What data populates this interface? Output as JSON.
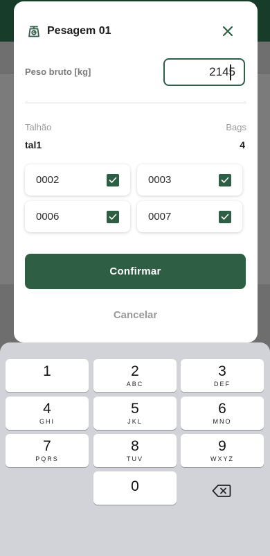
{
  "modal": {
    "title": "Pesagem 01",
    "peso_label": "Peso bruto [kg]",
    "peso_value": "2145",
    "talhao_header": "Talhão",
    "bags_header": "Bags",
    "talhao_value": "tal1",
    "bags_value": "4",
    "bags": [
      {
        "code": "0002",
        "checked": true
      },
      {
        "code": "0003",
        "checked": true
      },
      {
        "code": "0006",
        "checked": true
      },
      {
        "code": "0007",
        "checked": true
      }
    ],
    "confirm_label": "Confirmar",
    "cancel_label": "Cancelar"
  },
  "keyboard": {
    "keys": [
      {
        "num": "1",
        "letters": ""
      },
      {
        "num": "2",
        "letters": "ABC"
      },
      {
        "num": "3",
        "letters": "DEF"
      },
      {
        "num": "4",
        "letters": "GHI"
      },
      {
        "num": "5",
        "letters": "JKL"
      },
      {
        "num": "6",
        "letters": "MNO"
      },
      {
        "num": "7",
        "letters": "PQRS"
      },
      {
        "num": "8",
        "letters": "TUV"
      },
      {
        "num": "9",
        "letters": "WXYZ"
      },
      {
        "num": "0",
        "letters": ""
      }
    ],
    "backspace_icon": "backspace-icon"
  },
  "colors": {
    "primary": "#2e5e44",
    "header_dark": "#183c2a",
    "keyboard_bg": "#d1d3d9"
  }
}
